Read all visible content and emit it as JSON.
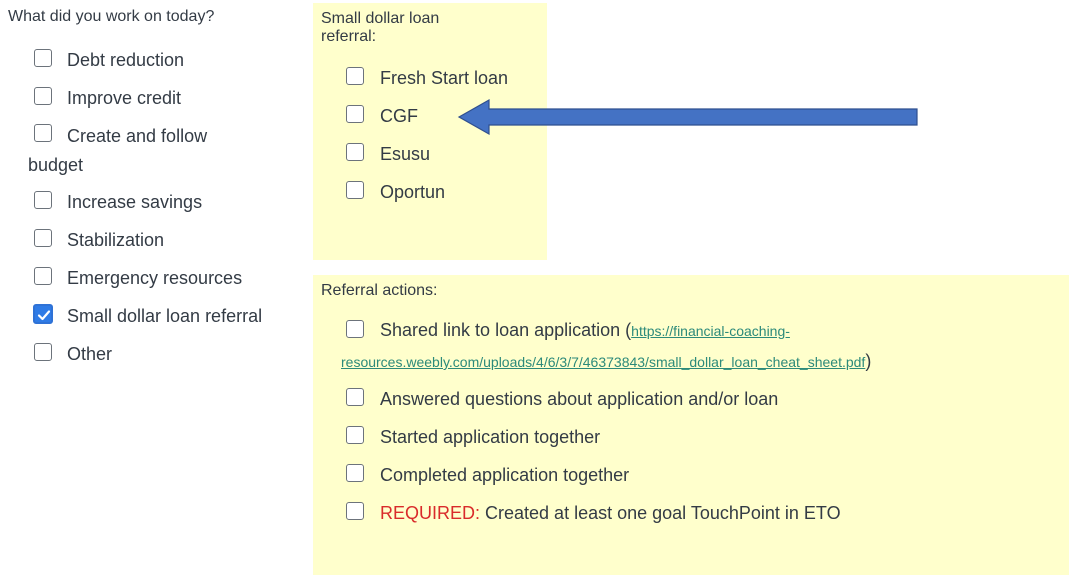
{
  "work_section": {
    "question": "What did you work on today?",
    "options": [
      {
        "label": "Debt reduction",
        "checked": false
      },
      {
        "label": "Improve credit",
        "checked": false
      },
      {
        "label": "Create and follow",
        "label_cont": "budget",
        "checked": false
      },
      {
        "label": "Increase savings",
        "checked": false
      },
      {
        "label": "Stabilization",
        "checked": false
      },
      {
        "label": "Emergency resources",
        "checked": false
      },
      {
        "label": "Small dollar loan referral",
        "checked": true
      },
      {
        "label": "Other",
        "checked": false
      }
    ]
  },
  "loan_referral": {
    "title_line1": "Small dollar loan",
    "title_line2": "referral:",
    "options": [
      {
        "label": "Fresh Start loan",
        "checked": false
      },
      {
        "label": "CGF",
        "checked": false
      },
      {
        "label": "Esusu",
        "checked": false
      },
      {
        "label": "Oportun",
        "checked": false
      }
    ]
  },
  "referral_actions": {
    "title": "Referral actions:",
    "shared_link": {
      "label": "Shared link to loan application (",
      "link_part1": "https://financial-coaching-",
      "link_part2": "resources.weebly.com/uploads/4/6/3/7/46373843/small_dollar_loan_cheat_sheet.pdf",
      "closing": ")"
    },
    "options": [
      {
        "label": "Answered questions about application and/or loan",
        "checked": false
      },
      {
        "label": "Started application together",
        "checked": false
      },
      {
        "label": "Completed application together",
        "checked": false
      }
    ],
    "required_prefix": "REQUIRED:",
    "required_label": " Created at least one goal TouchPoint in ETO"
  },
  "colors": {
    "panel_background": "#ffffcc",
    "arrow_fill": "#4472c4",
    "arrow_stroke": "#2f4f8f",
    "checked": "#2f7be6",
    "required": "#d92b2b",
    "link": "#2c8a7a"
  },
  "annotation": {
    "arrow_icon": "left-arrow-icon"
  }
}
